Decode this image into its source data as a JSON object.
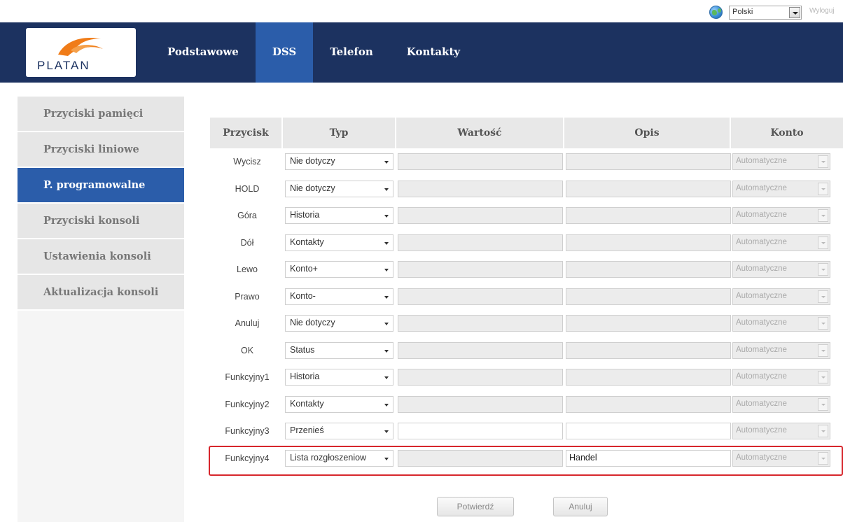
{
  "lang_bar": {
    "language": "Polski",
    "logout": "Wyloguj"
  },
  "logo": {
    "text": "PLATAN"
  },
  "nav": [
    {
      "label": "Podstawowe",
      "active": false
    },
    {
      "label": "DSS",
      "active": true
    },
    {
      "label": "Telefon",
      "active": false
    },
    {
      "label": "Kontakty",
      "active": false
    }
  ],
  "sidebar": [
    {
      "label": "Przyciski pamięci",
      "active": false
    },
    {
      "label": "Przyciski liniowe",
      "active": false
    },
    {
      "label": "P. programowalne",
      "active": true
    },
    {
      "label": "Przyciski konsoli",
      "active": false
    },
    {
      "label": "Ustawienia konsoli",
      "active": false
    },
    {
      "label": "Aktualizacja konsoli",
      "active": false
    }
  ],
  "table": {
    "headers": {
      "przycisk": "Przycisk",
      "typ": "Typ",
      "wartosc": "Wartość",
      "opis": "Opis",
      "konto": "Konto"
    },
    "rows": [
      {
        "przycisk": "Wycisz",
        "typ": "Nie dotyczy",
        "wartosc": "",
        "opis": "",
        "konto": "Automatyczne",
        "editable": false
      },
      {
        "przycisk": "HOLD",
        "typ": "Nie dotyczy",
        "wartosc": "",
        "opis": "",
        "konto": "Automatyczne",
        "editable": false
      },
      {
        "przycisk": "Góra",
        "typ": "Historia",
        "wartosc": "",
        "opis": "",
        "konto": "Automatyczne",
        "editable": false
      },
      {
        "przycisk": "Dół",
        "typ": "Kontakty",
        "wartosc": "",
        "opis": "",
        "konto": "Automatyczne",
        "editable": false
      },
      {
        "przycisk": "Lewo",
        "typ": "Konto+",
        "wartosc": "",
        "opis": "",
        "konto": "Automatyczne",
        "editable": false
      },
      {
        "przycisk": "Prawo",
        "typ": "Konto-",
        "wartosc": "",
        "opis": "",
        "konto": "Automatyczne",
        "editable": false
      },
      {
        "przycisk": "Anuluj",
        "typ": "Nie dotyczy",
        "wartosc": "",
        "opis": "",
        "konto": "Automatyczne",
        "editable": false
      },
      {
        "przycisk": "OK",
        "typ": "Status",
        "wartosc": "",
        "opis": "",
        "konto": "Automatyczne",
        "editable": false
      },
      {
        "przycisk": "Funkcyjny1",
        "typ": "Historia",
        "wartosc": "",
        "opis": "",
        "konto": "Automatyczne",
        "editable": false
      },
      {
        "przycisk": "Funkcyjny2",
        "typ": "Kontakty",
        "wartosc": "",
        "opis": "",
        "konto": "Automatyczne",
        "editable": false
      },
      {
        "przycisk": "Funkcyjny3",
        "typ": "Przenieś",
        "wartosc": "",
        "opis": "",
        "konto": "Automatyczne",
        "editable": true
      },
      {
        "przycisk": "Funkcyjny4",
        "typ": "Lista rozgłoszeniow",
        "wartosc": "",
        "opis": "Handel",
        "konto": "Automatyczne",
        "editable": "opis"
      }
    ]
  },
  "buttons": {
    "confirm": "Potwierdź",
    "cancel": "Anuluj"
  },
  "colors": {
    "header_bg": "#1c3260",
    "active_blue": "#2b5daa",
    "highlight_red": "#d7262c",
    "logo_orange": "#f07c18"
  }
}
